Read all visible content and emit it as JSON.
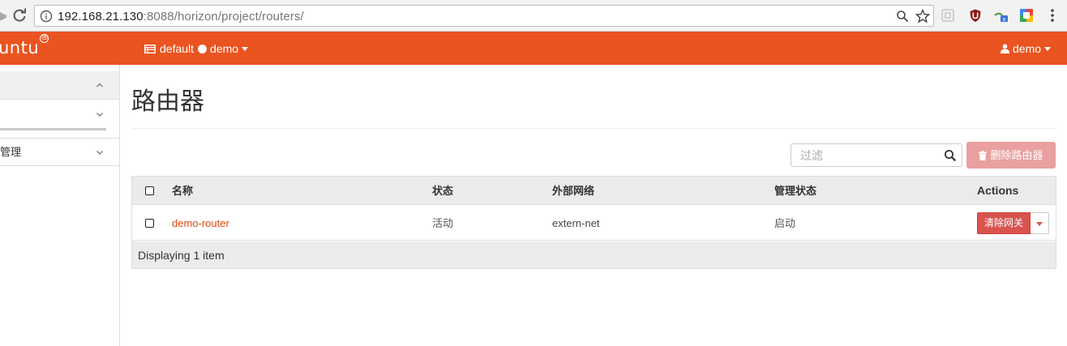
{
  "browser": {
    "url_host": "192.168.21.130",
    "url_rest": ":8088/horizon/project/routers/"
  },
  "topbar": {
    "brand": "untu",
    "brand_mark": "®",
    "project_domain": "default",
    "project_name": "demo",
    "user_name": "demo",
    "accent_color": "#e95420"
  },
  "sidebar": {
    "items": [
      {
        "label": "",
        "chevron": "chevron-up-icon",
        "active": true
      },
      {
        "label": "",
        "chevron": "chevron-down-icon",
        "active": false
      },
      {
        "label": "管理",
        "chevron": "chevron-down-icon",
        "active": false
      }
    ]
  },
  "page": {
    "title": "路由器"
  },
  "toolbar": {
    "filter_placeholder": "过滤",
    "delete_label": "删除路由器"
  },
  "table": {
    "columns": [
      "名称",
      "状态",
      "外部网络",
      "管理状态",
      "Actions"
    ],
    "rows": [
      {
        "name": "demo-router",
        "status": "活动",
        "external_network": "extern-net",
        "admin_state": "启动",
        "action_label": "清除网关"
      }
    ],
    "footer": "Displaying 1 item"
  }
}
